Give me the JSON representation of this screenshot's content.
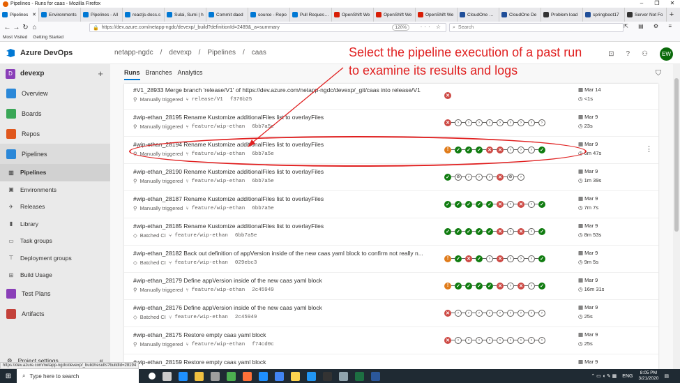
{
  "browser": {
    "window_title": "Pipelines - Runs for caas - Mozilla Firefox",
    "tabs": [
      {
        "label": "Pipelines",
        "color": "#0078d4",
        "active": true
      },
      {
        "label": "Environments",
        "color": "#0078d4"
      },
      {
        "label": "Pipelines - All",
        "color": "#0078d4"
      },
      {
        "label": "reactjs-docs.s",
        "color": "#0078d4"
      },
      {
        "label": "Sulai, Sumi | h",
        "color": "#0078d4"
      },
      {
        "label": "Commit daed",
        "color": "#0078d4"
      },
      {
        "label": "source - Repo",
        "color": "#0078d4"
      },
      {
        "label": "Pull Request b",
        "color": "#0078d4"
      },
      {
        "label": "OpenShift We",
        "color": "#d81e06"
      },
      {
        "label": "OpenShift We",
        "color": "#d81e06"
      },
      {
        "label": "OpenShift We",
        "color": "#d81e06"
      },
      {
        "label": "CloudOne Use",
        "color": "#1f4e99"
      },
      {
        "label": "CloudOne De",
        "color": "#1f4e99"
      },
      {
        "label": "Problem load",
        "color": "#333333"
      },
      {
        "label": "springboot17",
        "color": "#1f4e99"
      },
      {
        "label": "Server Not Fo",
        "color": "#333333"
      }
    ],
    "url": "https://dev.azure.com/netapp-ngdc/devexp/_build?definitionId=2489&_a=summary",
    "zoom": "120%",
    "search_placeholder": "Search",
    "bookmarks": [
      "Most Visited",
      "Getting Started"
    ],
    "status_url": "https://dev.azure.com/netapp-ngdc/devexp/_build/results?buildId=28194"
  },
  "ado": {
    "product": "Azure DevOps",
    "breadcrumb": [
      "netapp-ngdc",
      "/",
      "devexp",
      "/",
      "Pipelines",
      "/",
      "caas"
    ],
    "avatar": "EW",
    "project_initial": "D",
    "project_name": "devexp",
    "nav": {
      "overview": "Overview",
      "boards": "Boards",
      "repos": "Repos",
      "pipelines_section": "Pipelines",
      "pipelines": "Pipelines",
      "environments": "Environments",
      "releases": "Releases",
      "library": "Library",
      "task_groups": "Task groups",
      "deployment_groups": "Deployment groups",
      "build_usage": "Build Usage",
      "test_plans": "Test Plans",
      "artifacts": "Artifacts",
      "project_settings": "Project settings"
    },
    "tabs": [
      "Runs",
      "Branches",
      "Analytics"
    ]
  },
  "runs": [
    {
      "title": "#V1_28933 Merge branch 'release/V1' of https://dev.azure.com/netapp-ngdc/devexp/_git/caas into release/V1",
      "trigger": "Manually triggered",
      "branch": "release/V1",
      "commit": "f376b25",
      "stages": [
        "fail"
      ],
      "date": "Mar 14",
      "duration": "<1s"
    },
    {
      "title": "#wip-ethan_28195 Rename Kustomize additionalFiles list to overlayFiles",
      "trigger": "Manually triggered",
      "branch": "feature/wip-ethan",
      "commit": "6bb7a5e",
      "stages": [
        "fail",
        "skip",
        "skip",
        "skip",
        "skip",
        "skip",
        "skip",
        "skip",
        "skip",
        "skip"
      ],
      "date": "Mar 9",
      "duration": "23s"
    },
    {
      "title": "#wip-ethan_28194 Rename Kustomize additionalFiles list to overlayFiles",
      "trigger": "Manually triggered",
      "branch": "feature/wip-ethan",
      "commit": "6bb7a5e",
      "stages": [
        "warn",
        "ok",
        "ok",
        "ok",
        "fail",
        "fail",
        "skip",
        "skip",
        "skip",
        "ok"
      ],
      "date": "Mar 9",
      "duration": "6m 47s",
      "more": true
    },
    {
      "title": "#wip-ethan_28190 Rename Kustomize additionalFiles list to overlayFiles",
      "trigger": "Manually triggered",
      "branch": "feature/wip-ethan",
      "commit": "6bb7a5e",
      "stages": [
        "ok",
        "cancel",
        "skip",
        "skip",
        "skip",
        "fail",
        "cancel",
        "skip"
      ],
      "date": "Mar 9",
      "duration": "1m 39s"
    },
    {
      "title": "#wip-ethan_28187 Rename Kustomize additionalFiles list to overlayFiles",
      "trigger": "Manually triggered",
      "branch": "feature/wip-ethan",
      "commit": "6bb7a5e",
      "stages": [
        "ok",
        "ok",
        "ok",
        "ok",
        "ok",
        "fail",
        "skip",
        "fail",
        "skip",
        "ok"
      ],
      "date": "Mar 9",
      "duration": "7m 7s"
    },
    {
      "title": "#wip-ethan_28185 Rename Kustomize additionalFiles list to overlayFiles",
      "trigger": "Batched CI",
      "branch": "feature/wip-ethan",
      "commit": "6bb7a5e",
      "stages": [
        "ok",
        "ok",
        "ok",
        "ok",
        "ok",
        "fail",
        "skip",
        "fail",
        "skip",
        "ok"
      ],
      "date": "Mar 9",
      "duration": "8m 53s"
    },
    {
      "title": "#wip-ethan_28182 Back out definition of appVersion inside of the new caas yaml block to confirm not really n...",
      "trigger": "Batched CI",
      "branch": "feature/wip-ethan",
      "commit": "029ebc3",
      "stages": [
        "warn",
        "ok",
        "fail",
        "ok",
        "skip",
        "fail",
        "skip",
        "skip",
        "skip",
        "ok"
      ],
      "date": "Mar 9",
      "duration": "9m 5s"
    },
    {
      "title": "#wip-ethan_28179 Define appVersion inside of the new caas yaml block",
      "trigger": "Manually triggered",
      "branch": "feature/wip-ethan",
      "commit": "2c45949",
      "stages": [
        "warn",
        "ok",
        "ok",
        "ok",
        "ok",
        "fail",
        "skip",
        "fail",
        "skip",
        "ok"
      ],
      "date": "Mar 9",
      "duration": "16m 31s"
    },
    {
      "title": "#wip-ethan_28176 Define appVersion inside of the new caas yaml block",
      "trigger": "Batched CI",
      "branch": "feature/wip-ethan",
      "commit": "2c45949",
      "stages": [
        "fail",
        "skip",
        "skip",
        "skip",
        "skip",
        "skip",
        "skip",
        "skip",
        "skip",
        "skip"
      ],
      "date": "Mar 9",
      "duration": "25s"
    },
    {
      "title": "#wip-ethan_28175 Restore empty caas yaml block",
      "trigger": "Manually triggered",
      "branch": "feature/wip-ethan",
      "commit": "f74cd0c",
      "stages": [
        "fail",
        "skip",
        "skip",
        "skip",
        "skip",
        "skip",
        "skip",
        "skip",
        "skip",
        "skip"
      ],
      "date": "Mar 9",
      "duration": "25s"
    },
    {
      "title": "#wip-ethan_28159 Restore empty caas yaml block",
      "trigger": "",
      "branch": "",
      "commit": "",
      "stages": [],
      "date": "Mar 9",
      "duration": ""
    }
  ],
  "annotation": {
    "line1": "Select the pipeline execution of a past run",
    "line2": "to examine its results and logs"
  },
  "taskbar": {
    "search_placeholder": "Type here to search",
    "lang": "ENG",
    "time": "8:05 PM",
    "date": "3/21/2020"
  },
  "colors": {
    "ok": "#107c10",
    "fail": "#cd4a45",
    "warn": "#e07c1b",
    "accent": "#0078d4",
    "annotation": "#e02020"
  }
}
